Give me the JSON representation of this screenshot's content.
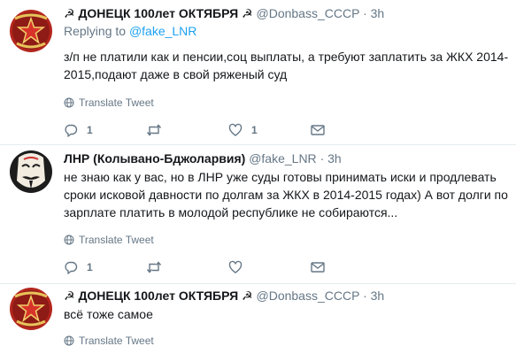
{
  "tweets": [
    {
      "name": "☭ ДОНЕЦК 100лет ОКТЯБРЯ ☭",
      "handle": "@Donbass_CCCP",
      "dot": "·",
      "time": "3h",
      "replying_prefix": "Replying to",
      "replying_to": "@fake_LNR",
      "text": "з/п не платили как и пенсии,соц выплаты, а требуют заплатить за ЖКХ 2014-2015,подают даже в свой ряженый суд",
      "translate": "Translate Tweet",
      "reply_count": "1",
      "retweet_count": "",
      "like_count": "1"
    },
    {
      "name": "ЛНР (Колывано-Бджоларвия)",
      "handle": "@fake_LNR",
      "dot": "·",
      "time": "3h",
      "text": "не знаю как у вас, но в ЛНР уже суды готовы принимать иски и продлевать сроки исковой давности по долгам за ЖКХ в 2014-2015 годах) А вот долги по зарплате платить в молодой республике не собираются...",
      "translate": "Translate Tweet",
      "reply_count": "1",
      "retweet_count": "",
      "like_count": ""
    },
    {
      "name": "☭ ДОНЕЦК 100лет ОКТЯБРЯ ☭",
      "handle": "@Donbass_CCCP",
      "dot": "·",
      "time": "3h",
      "text": "всё тоже самое",
      "translate": "Translate Tweet"
    }
  ],
  "icons": {
    "avatar_soviet": "red-star-avatar",
    "avatar_mask": "guy-fawkes-mask-avatar",
    "translate": "globe-icon",
    "reply": "reply-icon",
    "retweet": "retweet-icon",
    "like": "heart-icon",
    "dm": "envelope-icon"
  },
  "colors": {
    "link": "#1da1f2",
    "muted": "#657786",
    "text": "#14171a",
    "divider": "#e6ecf0"
  }
}
